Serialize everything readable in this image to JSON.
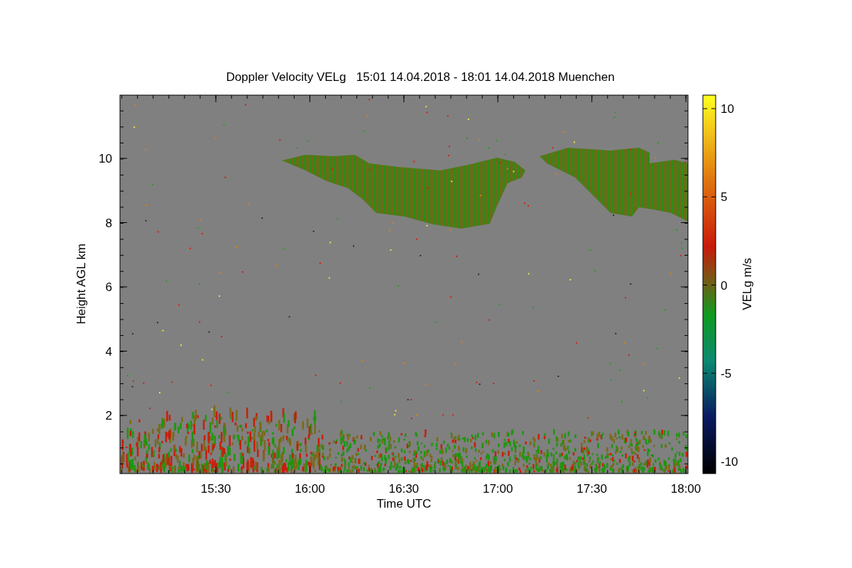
{
  "title": "Doppler Velocity VELg   15:01 14.04.2018 - 18:01 14.04.2018 Muenchen",
  "x_axis": {
    "label": "Time UTC",
    "ticks": [
      "15:30",
      "16:00",
      "16:30",
      "17:00",
      "17:30",
      "18:00"
    ]
  },
  "y_axis": {
    "label": "Height AGL km",
    "ticks": [
      "10",
      "8",
      "6",
      "4",
      "2"
    ]
  },
  "colorbar": {
    "label": "VELg m/s",
    "ticks": [
      "10",
      "5",
      "0",
      "-5",
      "-10"
    ]
  }
}
